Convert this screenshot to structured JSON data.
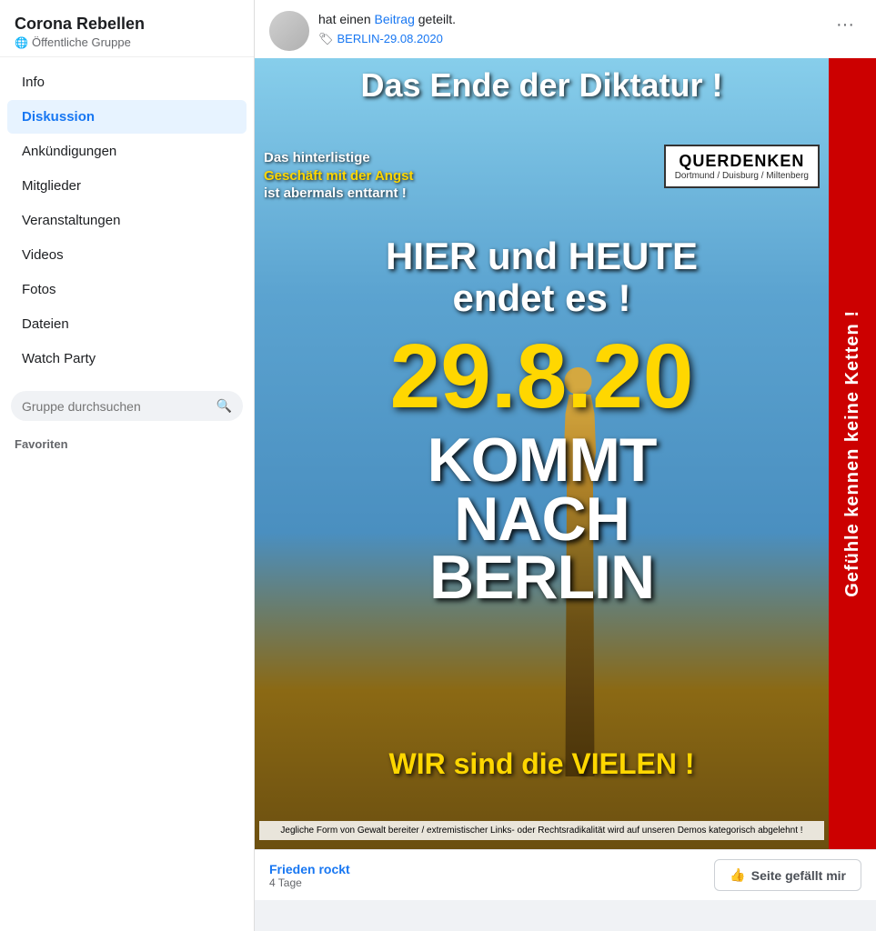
{
  "sidebar": {
    "group_name": "Corona Rebellen",
    "group_type": "Öffentliche Gruppe",
    "nav_items": [
      {
        "label": "Info",
        "active": false,
        "id": "info"
      },
      {
        "label": "Diskussion",
        "active": true,
        "id": "diskussion"
      },
      {
        "label": "Ankündigungen",
        "active": false,
        "id": "ankuendigungen"
      },
      {
        "label": "Mitglieder",
        "active": false,
        "id": "mitglieder"
      },
      {
        "label": "Veranstaltungen",
        "active": false,
        "id": "veranstaltungen"
      },
      {
        "label": "Videos",
        "active": false,
        "id": "videos"
      },
      {
        "label": "Fotos",
        "active": false,
        "id": "fotos"
      },
      {
        "label": "Dateien",
        "active": false,
        "id": "dateien"
      },
      {
        "label": "Watch Party",
        "active": false,
        "id": "watchparty"
      }
    ],
    "search_placeholder": "Gruppe durchsuchen",
    "favorites_label": "Favoriten"
  },
  "post": {
    "shared_text": "hat einen",
    "link_text": "Beitrag",
    "shared_suffix": "geteilt.",
    "tag_label": "BERLIN-29.08.2020",
    "more_options": "···",
    "poster": {
      "title": "Das Ende der Diktatur !",
      "subtitle_line1": "Das hinterlistige",
      "subtitle_highlight": "Geschäft mit der Angst",
      "subtitle_line2": "ist abermals enttarnt !",
      "querdenken_brand": "QUERDENKEN",
      "querdenken_cities": "Dortmund / Duisburg / Miltenberg",
      "hier_heute_line1": "HIER und HEUTE",
      "hier_heute_line2": "endet es !",
      "date": "29.8.20",
      "kommt_line1": "KOMMT",
      "kommt_line2": "NACH",
      "kommt_line3": "BERLIN",
      "wir_text": "WIR sind die VIELEN !",
      "disclaimer": "Jegliche Form von Gewalt bereiter / extremistischer Links- oder\nRechtsradikalität wird auf unseren Demos kategorisch abgelehnt !",
      "red_banner_text": "Gefühle kennen keine Ketten !"
    },
    "footer": {
      "link_text": "Frieden rockt",
      "sub_text": "4 Tage",
      "like_button": "Seite gefällt mir",
      "thumbs_icon": "👍"
    }
  }
}
